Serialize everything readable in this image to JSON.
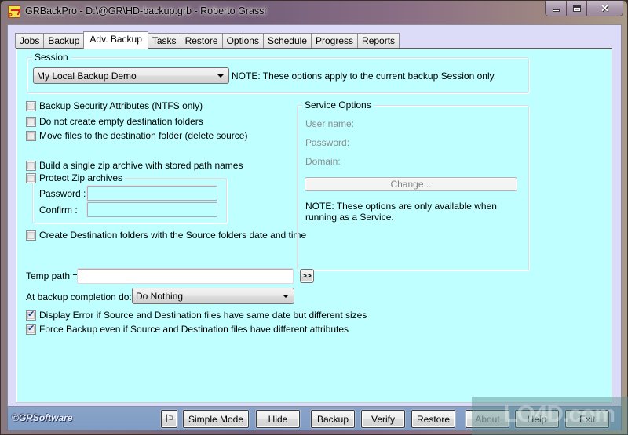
{
  "window": {
    "title": "GRBackPro - D:\\@GR\\HD-backup.grb - Roberto Grassi",
    "controls": {
      "minimize": "minimize",
      "maximize": "maximize",
      "close": "close"
    }
  },
  "tabs": [
    {
      "label": "Jobs",
      "active": false
    },
    {
      "label": "Backup",
      "active": false
    },
    {
      "label": "Adv. Backup",
      "active": true
    },
    {
      "label": "Tasks",
      "active": false
    },
    {
      "label": "Restore",
      "active": false
    },
    {
      "label": "Options",
      "active": false
    },
    {
      "label": "Schedule",
      "active": false
    },
    {
      "label": "Progress",
      "active": false
    },
    {
      "label": "Reports",
      "active": false
    }
  ],
  "session": {
    "group_label": "Session",
    "selected": "My Local Backup Demo",
    "note": "NOTE: These options apply to the current backup Session only."
  },
  "options": [
    {
      "label": "Backup Security Attributes (NTFS only)",
      "checked": false
    },
    {
      "label": "Do not create empty destination folders",
      "checked": false
    },
    {
      "label": "Move files to the destination folder (delete source)",
      "checked": false
    },
    {
      "label": "Build a single zip archive with stored path names",
      "checked": false
    }
  ],
  "zip": {
    "protect_label": "Protect Zip archives",
    "protect_checked": false,
    "password_label": "Password :",
    "password_value": "",
    "confirm_label": "Confirm :",
    "confirm_value": ""
  },
  "create_dest_dates": {
    "label": "Create Destination folders with the Source folders date and time",
    "checked": false
  },
  "service": {
    "group_label": "Service Options",
    "username_label": "User name:",
    "password_label": "Password:",
    "domain_label": "Domain:",
    "change_button": "Change...",
    "note": "NOTE: These options are only available when running as a Service."
  },
  "temp_path": {
    "label": "Temp path =",
    "value": "",
    "browse_button": ">>"
  },
  "completion": {
    "label": "At backup completion do:",
    "selected": "Do Nothing"
  },
  "final_options": [
    {
      "label": "Display Error if Source and Destination files have same date but different sizes",
      "checked": true
    },
    {
      "label": "Force Backup even if Source and Destination files have different attributes",
      "checked": true
    }
  ],
  "footer": {
    "brand": "©GRSoftware",
    "flag_icon": "flag-icon",
    "buttons": {
      "simple_mode": "Simple Mode",
      "hide": "Hide",
      "backup": "Backup",
      "verify": "Verify",
      "restore": "Restore",
      "about": "About",
      "help": "Help",
      "exit": "Exit"
    }
  },
  "watermark": "LO4D.com"
}
